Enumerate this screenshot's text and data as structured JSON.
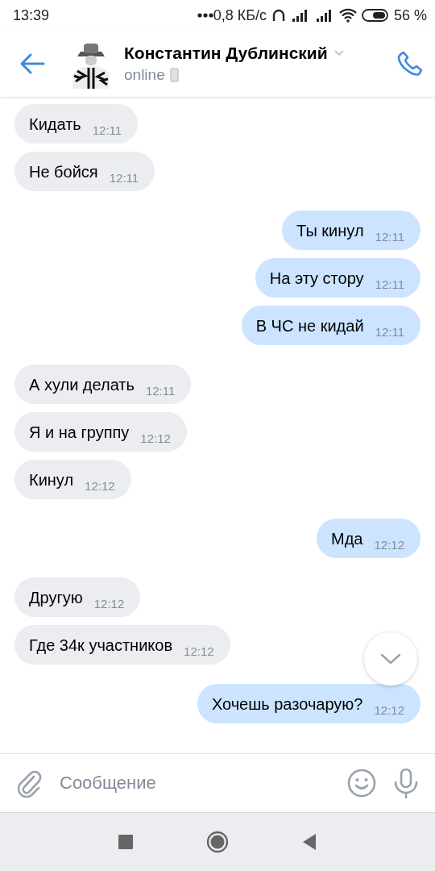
{
  "status_bar": {
    "time": "13:39",
    "speed": "0,8 КБ/с",
    "battery": "56 %"
  },
  "header": {
    "name": "Константин Дублинский",
    "status": "online"
  },
  "messages": [
    {
      "text": "Кидать",
      "time": "12:11",
      "outgoing": false
    },
    {
      "text": "Не бойся",
      "time": "12:11",
      "outgoing": false
    },
    {
      "text": "Ты кинул",
      "time": "12:11",
      "outgoing": true
    },
    {
      "text": "На эту стору",
      "time": "12:11",
      "outgoing": true
    },
    {
      "text": "В ЧС не кидай",
      "time": "12:11",
      "outgoing": true
    },
    {
      "text": "А хули делать",
      "time": "12:11",
      "outgoing": false
    },
    {
      "text": "Я и на группу",
      "time": "12:12",
      "outgoing": false
    },
    {
      "text": "Кинул",
      "time": "12:12",
      "outgoing": false
    },
    {
      "text": "Мда",
      "time": "12:12",
      "outgoing": true
    },
    {
      "text": "Другую",
      "time": "12:12",
      "outgoing": false
    },
    {
      "text": "Где 34к участников",
      "time": "12:12",
      "outgoing": false
    },
    {
      "text": "Хочешь разочарую?",
      "time": "12:12",
      "outgoing": true
    }
  ],
  "composer": {
    "placeholder": "Сообщение"
  }
}
